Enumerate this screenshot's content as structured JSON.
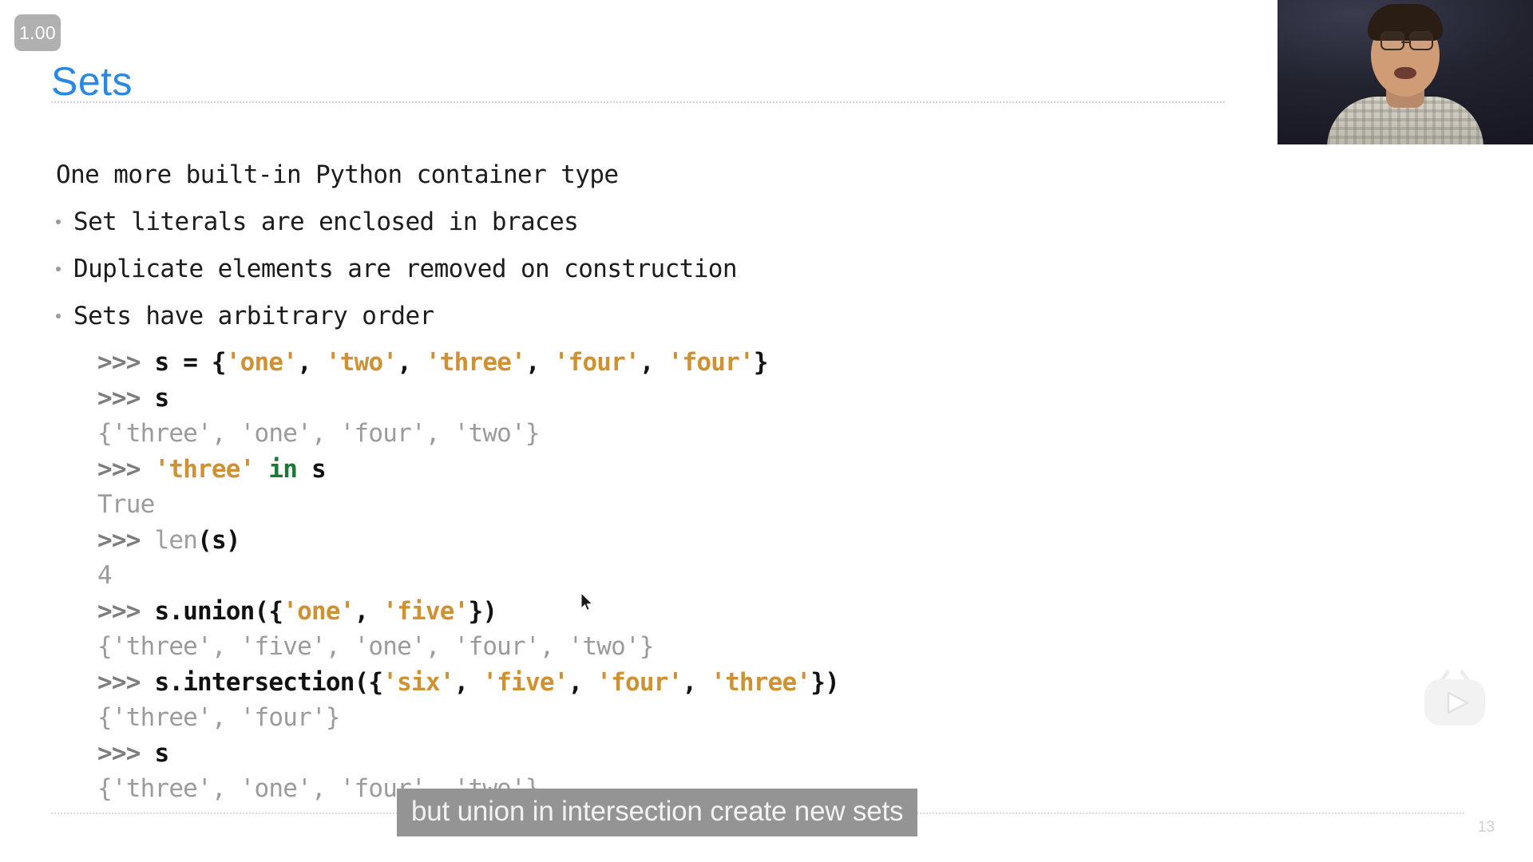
{
  "playback": {
    "rate_label": "1.00"
  },
  "slide": {
    "title": "Sets",
    "page_number": "13",
    "body_lines": [
      {
        "text": "One more built-in Python container type",
        "bullet": false
      },
      {
        "text": "Set literals are enclosed in braces",
        "bullet": true
      },
      {
        "text": "Duplicate elements are removed on construction",
        "bullet": true
      },
      {
        "text": "Sets have arbitrary order",
        "bullet": true
      }
    ],
    "code_lines": [
      {
        "kind": "input",
        "text": ">>> s = {'one', 'two', 'three', 'four', 'four'}",
        "tokens": [
          {
            "t": ">>> ",
            "c": "prompt"
          },
          {
            "t": "s",
            "c": "name"
          },
          {
            "t": " = {",
            "c": "punct"
          },
          {
            "t": "'one'",
            "c": "str"
          },
          {
            "t": ", ",
            "c": "punct"
          },
          {
            "t": "'two'",
            "c": "str"
          },
          {
            "t": ", ",
            "c": "punct"
          },
          {
            "t": "'three'",
            "c": "str"
          },
          {
            "t": ", ",
            "c": "punct"
          },
          {
            "t": "'four'",
            "c": "str"
          },
          {
            "t": ", ",
            "c": "punct"
          },
          {
            "t": "'four'",
            "c": "str"
          },
          {
            "t": "}",
            "c": "punct"
          }
        ]
      },
      {
        "kind": "input",
        "text": ">>> s",
        "tokens": [
          {
            "t": ">>> ",
            "c": "prompt"
          },
          {
            "t": "s",
            "c": "name"
          }
        ]
      },
      {
        "kind": "output",
        "text": "{'three', 'one', 'four', 'two'}",
        "tokens": [
          {
            "t": "{'three', 'one', 'four', 'two'}",
            "c": "out"
          }
        ]
      },
      {
        "kind": "input",
        "text": ">>> 'three' in s",
        "tokens": [
          {
            "t": ">>> ",
            "c": "prompt"
          },
          {
            "t": "'three'",
            "c": "str"
          },
          {
            "t": " ",
            "c": "punct"
          },
          {
            "t": "in",
            "c": "kw"
          },
          {
            "t": " ",
            "c": "punct"
          },
          {
            "t": "s",
            "c": "name"
          }
        ]
      },
      {
        "kind": "output",
        "text": "True",
        "tokens": [
          {
            "t": "True",
            "c": "out"
          }
        ]
      },
      {
        "kind": "input",
        "text": ">>> len(s)",
        "tokens": [
          {
            "t": ">>> ",
            "c": "prompt"
          },
          {
            "t": "len",
            "c": "builtin"
          },
          {
            "t": "(",
            "c": "punct"
          },
          {
            "t": "s",
            "c": "name"
          },
          {
            "t": ")",
            "c": "punct"
          }
        ]
      },
      {
        "kind": "output",
        "text": "4",
        "tokens": [
          {
            "t": "4",
            "c": "out"
          }
        ]
      },
      {
        "kind": "input",
        "text": ">>> s.union({'one', 'five'})",
        "tokens": [
          {
            "t": ">>> ",
            "c": "prompt"
          },
          {
            "t": "s.union",
            "c": "name"
          },
          {
            "t": "({",
            "c": "punct"
          },
          {
            "t": "'one'",
            "c": "str"
          },
          {
            "t": ", ",
            "c": "punct"
          },
          {
            "t": "'five'",
            "c": "str"
          },
          {
            "t": "})",
            "c": "punct"
          }
        ]
      },
      {
        "kind": "output",
        "text": "{'three', 'five', 'one', 'four', 'two'}",
        "tokens": [
          {
            "t": "{'three', 'five', 'one', 'four', 'two'}",
            "c": "out"
          }
        ]
      },
      {
        "kind": "input",
        "text": ">>> s.intersection({'six', 'five', 'four', 'three'})",
        "tokens": [
          {
            "t": ">>> ",
            "c": "prompt"
          },
          {
            "t": "s.intersection",
            "c": "name"
          },
          {
            "t": "({",
            "c": "punct"
          },
          {
            "t": "'six'",
            "c": "str"
          },
          {
            "t": ", ",
            "c": "punct"
          },
          {
            "t": "'five'",
            "c": "str"
          },
          {
            "t": ", ",
            "c": "punct"
          },
          {
            "t": "'four'",
            "c": "str"
          },
          {
            "t": ", ",
            "c": "punct"
          },
          {
            "t": "'three'",
            "c": "str"
          },
          {
            "t": "})",
            "c": "punct"
          }
        ]
      },
      {
        "kind": "output",
        "text": "{'three', 'four'}",
        "tokens": [
          {
            "t": "{'three', 'four'}",
            "c": "out"
          }
        ]
      },
      {
        "kind": "input",
        "text": ">>> s",
        "tokens": [
          {
            "t": ">>> ",
            "c": "prompt"
          },
          {
            "t": "s",
            "c": "name"
          }
        ]
      },
      {
        "kind": "output",
        "text": "{'three', 'one', 'four', 'two'}",
        "tokens": [
          {
            "t": "{'three', 'one', 'four', 'two'}",
            "c": "out"
          }
        ]
      }
    ]
  },
  "caption": {
    "text": "but union in intersection create new sets"
  },
  "colors": {
    "title_blue": "#2b88e0",
    "string_orange": "#cf9233",
    "keyword_green": "#1a7a33",
    "output_gray": "#9b9b9b",
    "caption_background": "#949494",
    "rate_badge_background": "#b0b0b0"
  },
  "icons": {
    "play_widget": "play-tv-icon",
    "cursor": "mouse-pointer-icon"
  }
}
